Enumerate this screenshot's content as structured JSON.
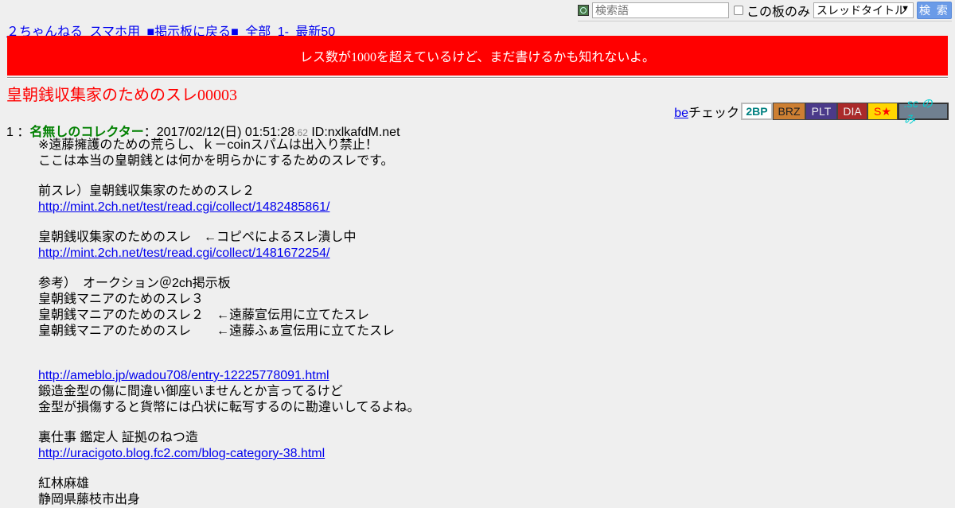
{
  "search": {
    "placeholder": "検索語",
    "board_only_label": "この板のみ",
    "scope_value": "スレッドタイトル",
    "button_label": "検 索"
  },
  "nav": {
    "items": [
      "２ちゃんねる",
      "スマホ用",
      "■掲示板に戻る■",
      "全部",
      "1-",
      "最新50"
    ]
  },
  "notice": "レス数が1000を超えているけど、まだ書けるかも知れないよ。",
  "thread_title": "皇朝銭収集家のためのスレ00003",
  "becheck": {
    "link": "be",
    "label": "チェック",
    "badges": [
      "2BP",
      "BRZ",
      "PLT",
      "DIA",
      "S★",
      ".sc のみ"
    ]
  },
  "post": {
    "number": "1",
    "separator": "：",
    "name": "名無しのコレクター",
    "date": "：2017/02/12(日) 01:51:28",
    "ms": ".62",
    "id": " ID:nxlkafdM.net",
    "lines": {
      "l1": "※遠藤擁護のための荒らし、ｋ－coinスパムは出入り禁止！",
      "l2": "ここは本当の皇朝銭とは何かを明らかにするためのスレです。",
      "l3": "前スレ）皇朝銭収集家のためのスレ２",
      "l4": "http://mint.2ch.net/test/read.cgi/collect/1482485861/",
      "l5": "皇朝銭収集家のためのスレ　←コピペによるスレ潰し中",
      "l6": "http://mint.2ch.net/test/read.cgi/collect/1481672254/",
      "l7": "参考）　オークション＠2ch掲示板",
      "l8": "皇朝銭マニアのためのスレ３",
      "l9": "皇朝銭マニアのためのスレ２　←遠藤宣伝用に立てたスレ",
      "l10": "皇朝銭マニアのためのスレ　　←遠藤ふぁ宣伝用に立てたスレ",
      "l11": "http://ameblo.jp/wadou708/entry-12225778091.html",
      "l12": "鍛造金型の傷に間違い御座いませんとか言ってるけど",
      "l13": "金型が損傷すると貨幣には凸状に転写するのに勘違いしてるよね。",
      "l14": "裏仕事 鑑定人 証拠のねつ造",
      "l15": "http://uracigoto.blog.fc2.com/blog-category-38.html",
      "l16": "紅林麻雄",
      "l17": "静岡県藤枝市出身"
    }
  }
}
